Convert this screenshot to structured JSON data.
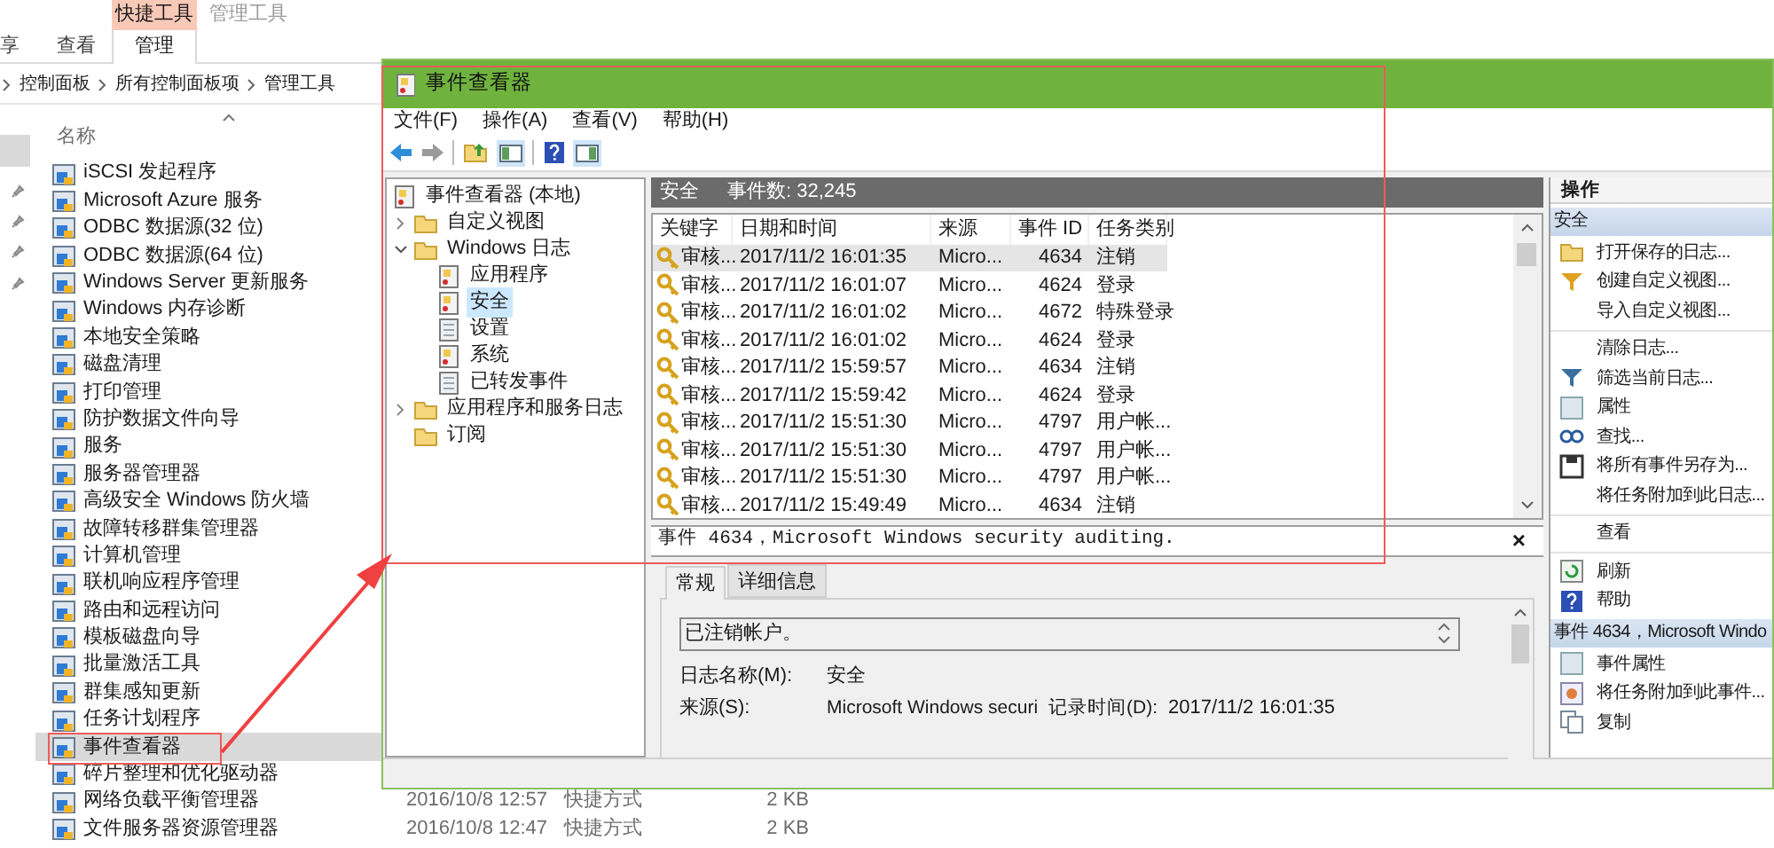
{
  "explorer": {
    "ribbon": {
      "context_group": "快捷工具",
      "inactive_group": "管理工具",
      "tabs": [
        {
          "label": "享",
          "selected": false
        },
        {
          "label": "查看",
          "selected": false
        },
        {
          "label": "管理",
          "selected": true
        }
      ]
    },
    "breadcrumb": [
      "控制面板",
      "所有控制面板项",
      "管理工具"
    ],
    "column": "名称",
    "items": [
      {
        "name": "iSCSI 发起程序",
        "selected": false
      },
      {
        "name": "Microsoft Azure 服务",
        "selected": false
      },
      {
        "name": "ODBC 数据源(32 位)",
        "selected": false
      },
      {
        "name": "ODBC 数据源(64 位)",
        "selected": false
      },
      {
        "name": "Windows Server 更新服务",
        "selected": false
      },
      {
        "name": "Windows 内存诊断",
        "selected": false
      },
      {
        "name": "本地安全策略",
        "selected": false
      },
      {
        "name": "磁盘清理",
        "selected": false
      },
      {
        "name": "打印管理",
        "selected": false
      },
      {
        "name": "防护数据文件向导",
        "selected": false
      },
      {
        "name": "服务",
        "selected": false
      },
      {
        "name": "服务器管理器",
        "selected": false
      },
      {
        "name": "高级安全 Windows 防火墙",
        "selected": false
      },
      {
        "name": "故障转移群集管理器",
        "selected": false
      },
      {
        "name": "计算机管理",
        "selected": false
      },
      {
        "name": "联机响应程序管理",
        "selected": false
      },
      {
        "name": "路由和远程访问",
        "selected": false
      },
      {
        "name": "模板磁盘向导",
        "selected": false
      },
      {
        "name": "批量激活工具",
        "selected": false
      },
      {
        "name": "群集感知更新",
        "selected": false
      },
      {
        "name": "任务计划程序",
        "selected": false
      },
      {
        "name": "事件查看器",
        "selected": true
      },
      {
        "name": "碎片整理和优化驱动器",
        "selected": false
      },
      {
        "name": "网络负载平衡管理器",
        "selected": false,
        "date": "2016/10/8 12:57",
        "type": "快捷方式",
        "size": "2 KB"
      },
      {
        "name": "文件服务器资源管理器",
        "selected": false,
        "date": "2016/10/8 12:47",
        "type": "快捷方式",
        "size": "2 KB"
      }
    ]
  },
  "window": {
    "title": "事件查看器",
    "menu": [
      "文件(F)",
      "操作(A)",
      "查看(V)",
      "帮助(H)"
    ],
    "tree": [
      {
        "label": "事件查看器 (本地)",
        "selected": false,
        "children": [
          {
            "label": "自定义视图",
            "selected": false,
            "expanded": false
          },
          {
            "label": "Windows 日志",
            "selected": false,
            "expanded": true,
            "children": [
              {
                "label": "应用程序",
                "selected": false
              },
              {
                "label": "安全",
                "selected": true
              },
              {
                "label": "设置",
                "selected": false
              },
              {
                "label": "系统",
                "selected": false
              },
              {
                "label": "已转发事件",
                "selected": false
              }
            ]
          },
          {
            "label": "应用程序和服务日志",
            "selected": false,
            "expanded": false
          },
          {
            "label": "订阅",
            "selected": false
          }
        ]
      }
    ],
    "log_header": {
      "name": "安全",
      "count": "事件数: 32,245"
    },
    "columns": [
      "关键字",
      "日期和时间",
      "来源",
      "事件 ID",
      "任务类别"
    ],
    "rows": [
      {
        "keyword": "审核...",
        "datetime": "2017/11/2 16:01:35",
        "source": "Micro...",
        "event_id": "4634",
        "category": "注销",
        "selected": true
      },
      {
        "keyword": "审核...",
        "datetime": "2017/11/2 16:01:07",
        "source": "Micro...",
        "event_id": "4624",
        "category": "登录",
        "selected": false
      },
      {
        "keyword": "审核...",
        "datetime": "2017/11/2 16:01:02",
        "source": "Micro...",
        "event_id": "4672",
        "category": "特殊登录",
        "selected": false
      },
      {
        "keyword": "审核...",
        "datetime": "2017/11/2 16:01:02",
        "source": "Micro...",
        "event_id": "4624",
        "category": "登录",
        "selected": false
      },
      {
        "keyword": "审核...",
        "datetime": "2017/11/2 15:59:57",
        "source": "Micro...",
        "event_id": "4634",
        "category": "注销",
        "selected": false
      },
      {
        "keyword": "审核...",
        "datetime": "2017/11/2 15:59:42",
        "source": "Micro...",
        "event_id": "4624",
        "category": "登录",
        "selected": false
      },
      {
        "keyword": "审核...",
        "datetime": "2017/11/2 15:51:30",
        "source": "Micro...",
        "event_id": "4797",
        "category": "用户帐...",
        "selected": false
      },
      {
        "keyword": "审核...",
        "datetime": "2017/11/2 15:51:30",
        "source": "Micro...",
        "event_id": "4797",
        "category": "用户帐...",
        "selected": false
      },
      {
        "keyword": "审核...",
        "datetime": "2017/11/2 15:51:30",
        "source": "Micro...",
        "event_id": "4797",
        "category": "用户帐...",
        "selected": false
      },
      {
        "keyword": "审核...",
        "datetime": "2017/11/2 15:49:49",
        "source": "Micro...",
        "event_id": "4634",
        "category": "注销",
        "selected": false
      }
    ],
    "details": {
      "title": "事件 4634，Microsoft Windows security auditing.",
      "close": "×",
      "tabs": [
        {
          "label": "常规",
          "selected": true
        },
        {
          "label": "详细信息",
          "selected": false
        }
      ],
      "description": "已注销帐户。",
      "log_name_label": "日志名称(M):",
      "log_name": "安全",
      "source_label": "来源(S):",
      "source": "Microsoft Windows securi",
      "logged_label": "记录时间(D):",
      "logged": "2017/11/2 16:01:35"
    },
    "actions": {
      "title": "操作",
      "sections": [
        {
          "title": "安全",
          "groups": [
            [
              "打开保存的日志...",
              "创建自定义视图...",
              "导入自定义视图..."
            ],
            [
              "清除日志...",
              "筛选当前日志...",
              "属性",
              "查找...",
              "将所有事件另存为...",
              "将任务附加到此日志..."
            ],
            [
              "查看"
            ],
            [
              "刷新",
              "帮助"
            ]
          ]
        },
        {
          "title": "事件 4634，Microsoft Windo",
          "groups": [
            [
              "事件属性",
              "将任务附加到此事件...",
              "复制"
            ]
          ]
        }
      ]
    }
  }
}
